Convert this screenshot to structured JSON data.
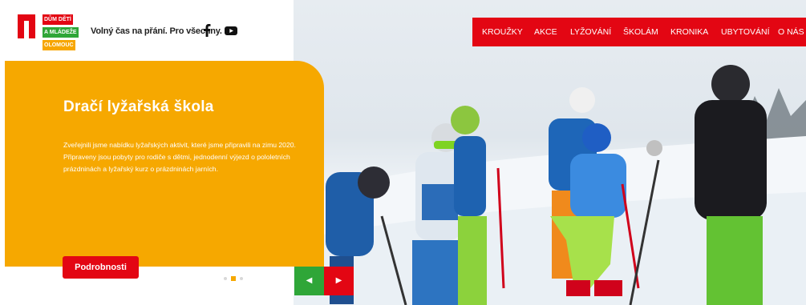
{
  "logo": {
    "lines": [
      "DŮM DĚTÍ",
      "A MLÁDEŽE",
      "OLOMOUC"
    ],
    "colors": {
      "red": "#e30613",
      "green": "#2fa638",
      "orange": "#f7a600"
    }
  },
  "header": {
    "tagline": "Volný čas na přání. Pro všechny.",
    "social": [
      "facebook-icon",
      "youtube-icon"
    ]
  },
  "nav": {
    "items": [
      "KROUŽKY",
      "AKCE",
      "LYŽOVÁNÍ",
      "ŠKOLÁM",
      "KRONIKA",
      "UBYTOVÁNÍ",
      "O NÁS"
    ]
  },
  "slide": {
    "title": "Dračí lyžařská škola",
    "body": "Zveřejnili jsme nabídku lyžařských aktivit, které jsme připravili na zimu 2020. Připraveny jsou pobyty pro rodiče s dětmi, jednodenní výjezd o pololetních prázdninách a lyžařský kurz o prázdninách jarních.",
    "button": "Podrobnosti",
    "slide_count": 3,
    "active_slide": 2
  },
  "controls": {
    "prev_icon": "prev-arrow-icon",
    "next_icon": "next-arrow-icon"
  },
  "colors": {
    "panel": "#f6a800",
    "nav": "#e30613",
    "prev": "#2fa638",
    "next": "#e30613"
  }
}
